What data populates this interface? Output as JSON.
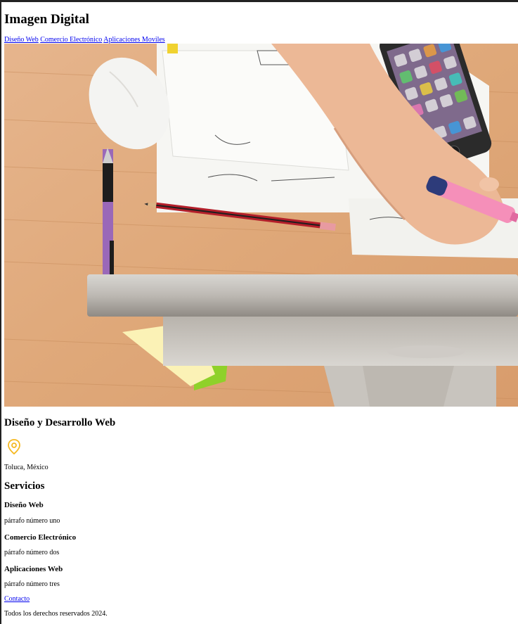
{
  "header": {
    "title": "Imagen Digital",
    "nav": [
      {
        "label": "Diseño Web"
      },
      {
        "label": "Comercio Electrónico"
      },
      {
        "label": "Aplicaciones Moviles"
      }
    ]
  },
  "main": {
    "heading": "Diseño y Desarrollo Web",
    "location_icon": "map-pin-icon",
    "location": "Toluca, México",
    "services": {
      "heading": "Servicios",
      "items": [
        {
          "title": "Diseño Web",
          "text": "párrafo número uno"
        },
        {
          "title": "Comercio Electrónico",
          "text": "párrafo número dos"
        },
        {
          "title": "Aplicaciones Web",
          "text": "párrafo número tres"
        }
      ]
    },
    "contact_link": "Contacto"
  },
  "footer": {
    "text": "Todos los derechos reservados 2024."
  },
  "colors": {
    "accent_icon": "#f5b820",
    "link": "#0000ee"
  }
}
